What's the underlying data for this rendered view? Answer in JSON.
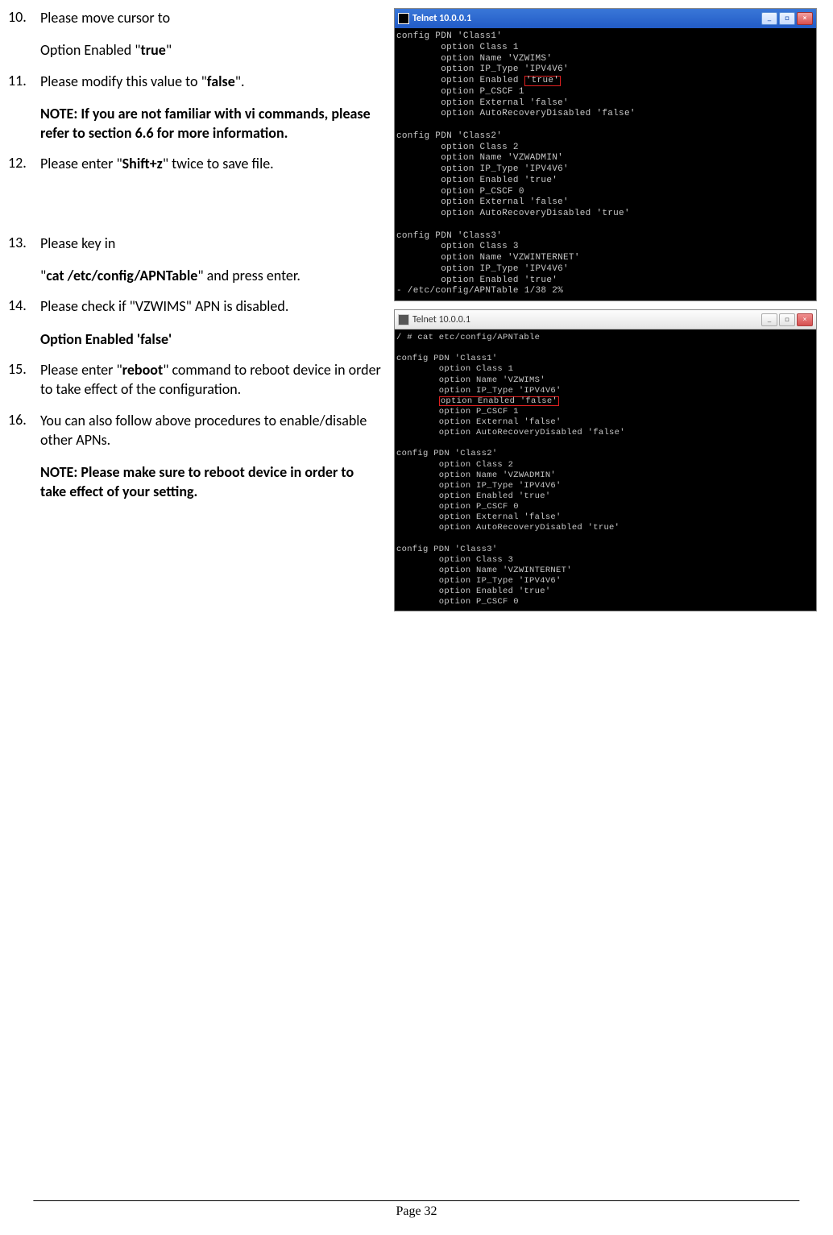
{
  "instructions": [
    {
      "num": "10.",
      "lines": [
        {
          "segs": [
            {
              "t": "Please move cursor to"
            }
          ]
        },
        {
          "segs": [
            {
              "t": "Option Enabled \""
            },
            {
              "t": "true",
              "b": true
            },
            {
              "t": "\""
            }
          ]
        }
      ]
    },
    {
      "num": "11.",
      "lines": [
        {
          "segs": [
            {
              "t": "Please modify this value to \""
            },
            {
              "t": "false",
              "b": true
            },
            {
              "t": "\"."
            }
          ]
        },
        {
          "segs": [
            {
              "t": "NOTE: If you are not familiar with vi commands, please refer to section 6.6 for more information.",
              "b": true
            }
          ]
        }
      ]
    },
    {
      "num": "12.",
      "lines": [
        {
          "segs": [
            {
              "t": "Please enter \""
            },
            {
              "t": "Shift+z",
              "b": true
            },
            {
              "t": "\" twice to save file."
            }
          ]
        }
      ],
      "afterGap": true
    },
    {
      "num": "13.",
      "lines": [
        {
          "segs": [
            {
              "t": "Please key in"
            }
          ]
        },
        {
          "segs": [
            {
              "t": "\""
            },
            {
              "t": "cat /etc/config/APNTable",
              "b": true
            },
            {
              "t": "\" and press enter."
            }
          ]
        }
      ]
    },
    {
      "num": "14.",
      "lines": [
        {
          "segs": [
            {
              "t": "Please check if \"VZWIMS\" APN is disabled."
            }
          ]
        },
        {
          "segs": [
            {
              "t": "Option Enabled 'false'",
              "b": true
            }
          ]
        }
      ]
    },
    {
      "num": "15.",
      "lines": [
        {
          "segs": [
            {
              "t": "Please enter \""
            },
            {
              "t": "reboot",
              "b": true
            },
            {
              "t": "\" command to reboot device in order to take effect of the configuration."
            }
          ]
        }
      ]
    },
    {
      "num": "16.",
      "lines": [
        {
          "segs": [
            {
              "t": "You can also follow above procedures to enable/disable other APNs."
            }
          ]
        },
        {
          "segs": [
            {
              "t": "NOTE: Please make sure to reboot device in order to take effect of your setting.",
              "b": true
            }
          ]
        }
      ]
    }
  ],
  "terminal1": {
    "title": "Telnet 10.0.0.1",
    "btnMin": "_",
    "btnMax": "□",
    "btnClose": "×",
    "prefix": "config PDN 'Class1'\n        option Class 1\n        option Name 'VZWIMS'\n        option IP_Type 'IPV4V6'\n        option Enabled ",
    "highlight": "'true'",
    "suffix": "\n        option P_CSCF 1\n        option External 'false'\n        option AutoRecoveryDisabled 'false'\n\nconfig PDN 'Class2'\n        option Class 2\n        option Name 'VZWADMIN'\n        option IP_Type 'IPV4V6'\n        option Enabled 'true'\n        option P_CSCF 0\n        option External 'false'\n        option AutoRecoveryDisabled 'true'\n\nconfig PDN 'Class3'\n        option Class 3\n        option Name 'VZWINTERNET'\n        option IP_Type 'IPV4V6'\n        option Enabled 'true'\n- /etc/config/APNTable 1/38 2%"
  },
  "terminal2": {
    "title": "Telnet 10.0.0.1",
    "btnMin": "_",
    "btnMax": "□",
    "btnClose": "×",
    "prefix": "/ # cat etc/config/APNTable\n\nconfig PDN 'Class1'\n        option Class 1\n        option Name 'VZWIMS'\n        option IP_Type 'IPV4V6'\n        ",
    "highlight": "option Enabled 'false'",
    "suffix": "\n        option P_CSCF 1\n        option External 'false'\n        option AutoRecoveryDisabled 'false'\n\nconfig PDN 'Class2'\n        option Class 2\n        option Name 'VZWADMIN'\n        option IP_Type 'IPV4V6'\n        option Enabled 'true'\n        option P_CSCF 0\n        option External 'false'\n        option AutoRecoveryDisabled 'true'\n\nconfig PDN 'Class3'\n        option Class 3\n        option Name 'VZWINTERNET'\n        option IP_Type 'IPV4V6'\n        option Enabled 'true'\n        option P_CSCF 0"
  },
  "footer": "Page 32"
}
